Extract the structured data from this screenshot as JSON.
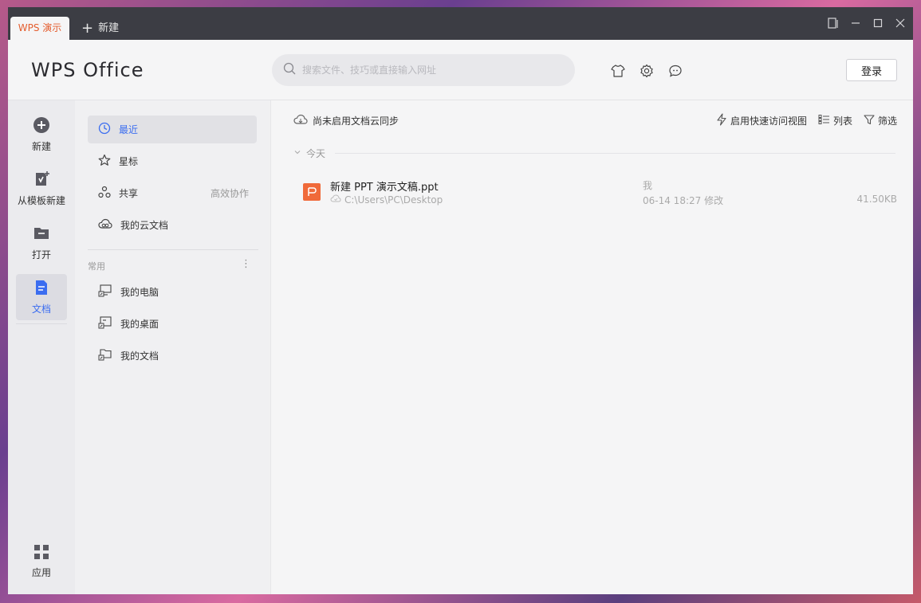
{
  "titlebar": {
    "active_tab": "WPS 演示",
    "new_tab": "新建"
  },
  "header": {
    "logo": "WPS Office",
    "search_placeholder": "搜索文件、技巧或直接输入网址",
    "login_label": "登录"
  },
  "rail": {
    "items": [
      {
        "label": "新建",
        "icon": "plus-circle-icon"
      },
      {
        "label": "从模板新建",
        "icon": "template-icon"
      },
      {
        "label": "打开",
        "icon": "folder-icon"
      },
      {
        "label": "文档",
        "icon": "document-icon"
      },
      {
        "label": "应用",
        "icon": "apps-grid-icon"
      }
    ]
  },
  "nav": {
    "items": [
      {
        "label": "最近",
        "icon": "clock-icon"
      },
      {
        "label": "星标",
        "icon": "star-icon"
      },
      {
        "label": "共享",
        "icon": "share-icon",
        "extra": "高效协作"
      },
      {
        "label": "我的云文档",
        "icon": "cloud-icon"
      }
    ],
    "section_title": "常用",
    "common": [
      {
        "label": "我的电脑"
      },
      {
        "label": "我的桌面"
      },
      {
        "label": "我的文档"
      }
    ]
  },
  "content": {
    "cloud_status": "尚未启用文档云同步",
    "toolbar": {
      "quick_view": "启用快速访问视图",
      "list": "列表",
      "filter": "筛选"
    },
    "group_label": "今天",
    "files": [
      {
        "name": "新建 PPT 演示文稿.ppt",
        "path": "C:\\Users\\PC\\Desktop",
        "owner": "我",
        "modified": "06-14 18:27 修改",
        "size": "41.50KB"
      }
    ]
  },
  "colors": {
    "accent": "#3b6df0",
    "wps_orange": "#e45d2e",
    "ppt_icon": "#f06a3a"
  }
}
